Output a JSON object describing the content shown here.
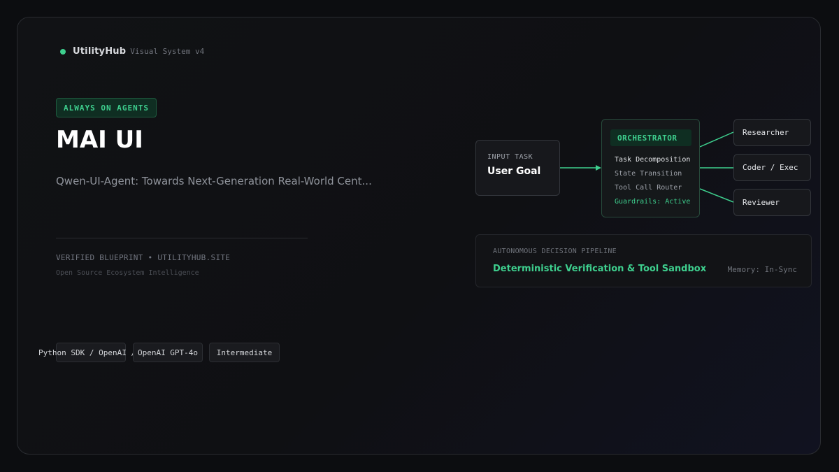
{
  "brand": {
    "name": "UtilityHub",
    "subtitle": "Visual System v4"
  },
  "hero": {
    "badge": "ALWAYS ON AGENTS",
    "title": "MAI UI",
    "subtitle": "Qwen-UI-Agent: Towards Next-Generation Real-World Cent...",
    "verified": "VERIFIED BLUEPRINT • UTILITYHUB.SITE",
    "tagline": "Open Source Ecosystem Intelligence"
  },
  "chips": [
    "Python SDK / OpenAI /",
    "OpenAI GPT-4o",
    "Intermediate"
  ],
  "diagram": {
    "input_label": "INPUT TASK",
    "input_value": "User Goal",
    "orchestrator": {
      "title": "ORCHESTRATOR",
      "items": [
        "Task Decomposition",
        "State Transition",
        "Tool Call Router",
        "Guardrails: Active"
      ]
    },
    "agents": [
      "Researcher",
      "Coder / Exec",
      "Reviewer"
    ]
  },
  "pipeline": {
    "label": "AUTONOMOUS DECISION PIPELINE",
    "title": "Deterministic Verification & Tool Sandbox",
    "memory": "Memory: In-Sync"
  },
  "colors": {
    "accent": "#3ecf8e",
    "background": "#0c0d10",
    "panel": "#17181c"
  }
}
